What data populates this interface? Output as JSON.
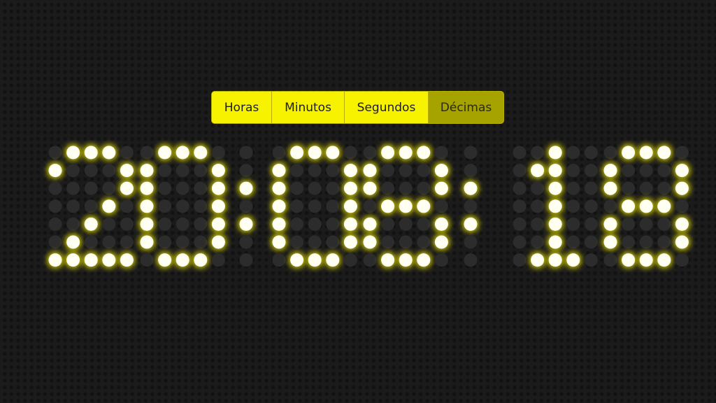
{
  "tabs": [
    {
      "label": "Horas",
      "active": false
    },
    {
      "label": "Minutos",
      "active": false
    },
    {
      "label": "Segundos",
      "active": false
    },
    {
      "label": "Décimas",
      "active": true
    }
  ],
  "display": {
    "text": "20:08:18",
    "led_color": "#fffff2",
    "glow_color": "#f5ee00",
    "led_off_color": "#2c2c2c"
  },
  "colors": {
    "tab_background": "#f7f200",
    "tab_active_background": "#a6a200",
    "page_background": "#1b1b1b"
  }
}
